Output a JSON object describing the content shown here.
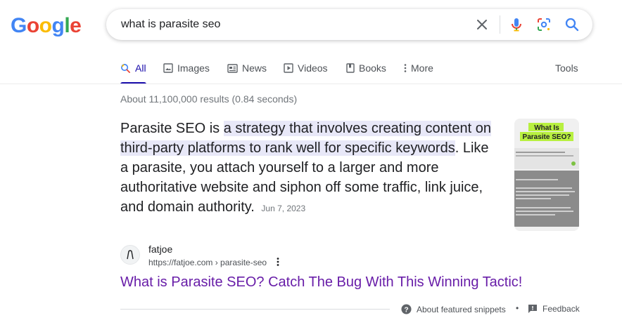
{
  "logo": {
    "letters": [
      "G",
      "o",
      "o",
      "g",
      "l",
      "e"
    ],
    "colors": [
      "#4285F4",
      "#EA4335",
      "#FBBC05",
      "#4285F4",
      "#34A853",
      "#EA4335"
    ]
  },
  "search": {
    "query": "what is parasite seo"
  },
  "tabs": [
    {
      "label": "All",
      "icon": "search-icon"
    },
    {
      "label": "Images",
      "icon": "image-icon"
    },
    {
      "label": "News",
      "icon": "news-icon"
    },
    {
      "label": "Videos",
      "icon": "play-icon"
    },
    {
      "label": "Books",
      "icon": "book-icon"
    },
    {
      "label": "More",
      "icon": "more-vert-icon"
    }
  ],
  "tools_label": "Tools",
  "result_stats": "About 11,100,000 results (0.84 seconds)",
  "featured": {
    "prefix": "Parasite SEO is ",
    "highlight": "a strategy that involves creating content on third-party platforms to rank well for specific keywords",
    "suffix": ". Like a parasite, you attach yourself to a larger and more authoritative website and siphon off some traffic, link juice, and domain authority.",
    "date": "Jun 7, 2023",
    "thumb_title_line1": "What Is",
    "thumb_title_line2": "Parasite SEO?"
  },
  "source": {
    "site_name": "fatjoe",
    "url": "https://fatjoe.com › parasite-seo",
    "title": "What is Parasite SEO? Catch The Bug With This Winning Tactic!"
  },
  "footer": {
    "about": "About featured snippets",
    "separator": "•",
    "feedback": "Feedback"
  },
  "colors": {
    "link": "#681da8",
    "active_tab": "#1a0dab",
    "highlight": "#e8e8f8"
  }
}
